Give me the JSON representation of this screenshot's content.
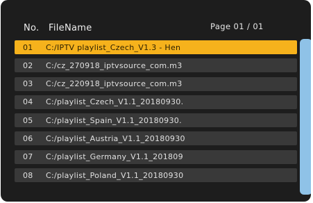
{
  "header": {
    "no_label": "No.",
    "filename_label": "FileName",
    "page_label": "Page 01 / 01"
  },
  "files": [
    {
      "num": "01",
      "name": "C:/IPTV playlist_Czech_V1.3 - Hen",
      "selected": true
    },
    {
      "num": "02",
      "name": "C:/cz_270918_iptvsource_com.m3",
      "selected": false
    },
    {
      "num": "03",
      "name": "C:/cz_220918_iptvsource_com.m3",
      "selected": false
    },
    {
      "num": "04",
      "name": "C:/playlist_Czech_V1.1_20180930.",
      "selected": false
    },
    {
      "num": "05",
      "name": "C:/playlist_Spain_V1.1_20180930.",
      "selected": false
    },
    {
      "num": "06",
      "name": "C:/playlist_Austria_V1.1_20180930",
      "selected": false
    },
    {
      "num": "07",
      "name": "C:/playlist_Germany_V1.1_201809",
      "selected": false
    },
    {
      "num": "08",
      "name": "C:/playlist_Poland_V1.1_20180930",
      "selected": false
    }
  ],
  "colors": {
    "selection": "#f6b21c",
    "row": "#393939",
    "scrollbar": "#8fc2e7",
    "background": "#1d1d1d"
  }
}
